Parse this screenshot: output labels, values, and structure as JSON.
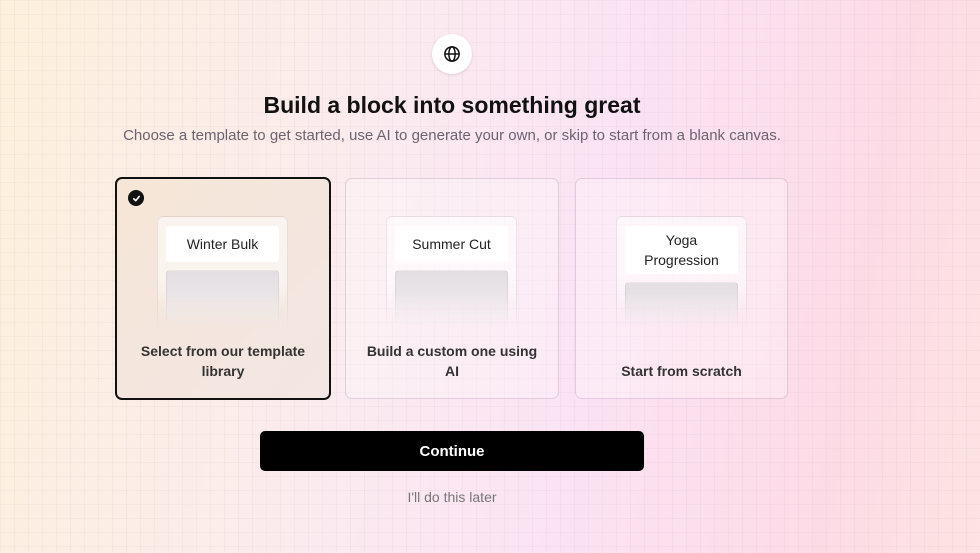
{
  "header": {
    "logo_icon": "globe-icon",
    "title": "Build a block into something great",
    "subtitle": "Choose a template to get started, use AI to generate your own, or skip to start from a blank canvas."
  },
  "options": [
    {
      "preview_label": "Winter Bulk",
      "caption": "Select from our template library",
      "selected": true
    },
    {
      "preview_label": "Summer Cut",
      "caption": "Build a custom one using AI",
      "selected": false
    },
    {
      "preview_label": "Yoga Progression",
      "caption": "Start from scratch",
      "selected": false
    }
  ],
  "actions": {
    "continue_label": "Continue",
    "later_label": "I'll do this later"
  },
  "colors": {
    "primary": "#000000",
    "subtitle_text": "#6b6470"
  }
}
